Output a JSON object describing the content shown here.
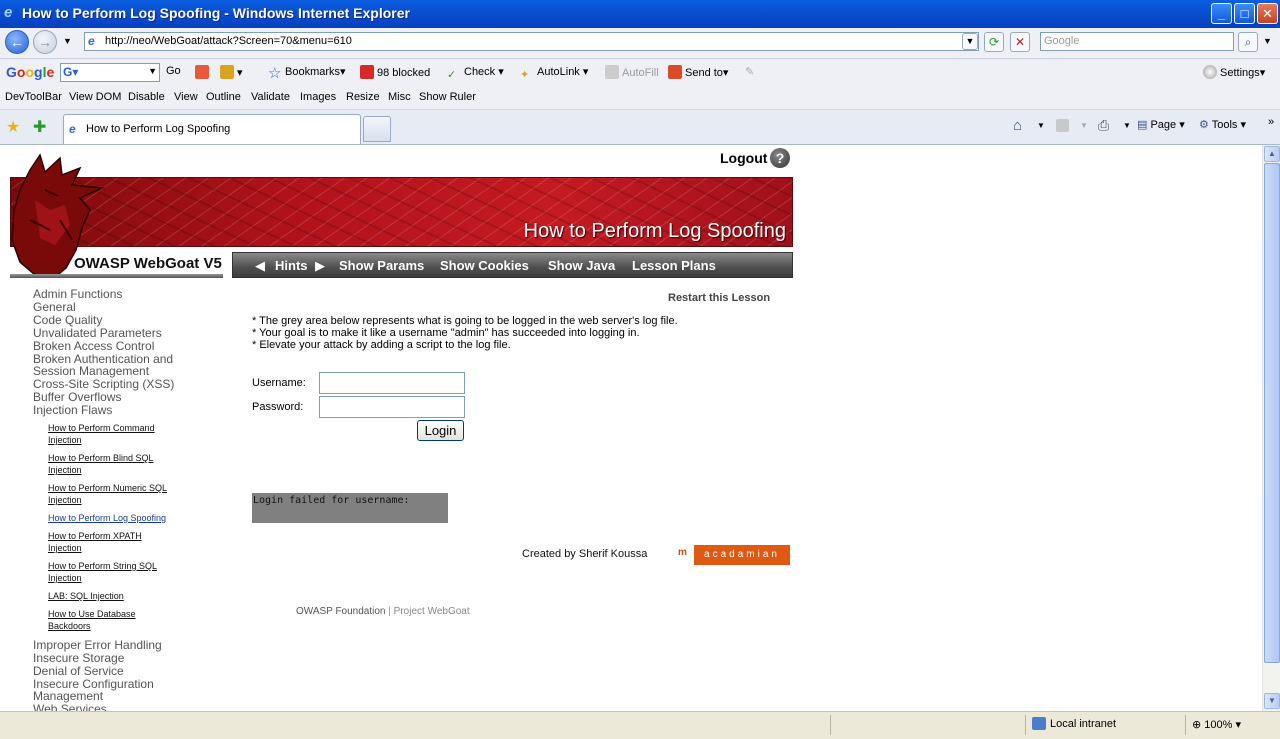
{
  "window": {
    "title": "How to Perform Log Spoofing - Windows Internet Explorer",
    "minimize": "_",
    "maximize": "□",
    "close": "✕"
  },
  "address_bar": {
    "url": "http://neo/WebGoat/attack?Screen=70&menu=610",
    "search_placeholder": "Google"
  },
  "google_toolbar": {
    "logo": "Google",
    "go": "Go",
    "bookmarks": "Bookmarks",
    "blocked": "98 blocked",
    "check": "Check",
    "autolink": "AutoLink",
    "autofill": "AutoFill",
    "sendto": "Send to",
    "settings": "Settings"
  },
  "dev_toolbar": {
    "items": [
      "DevToolBar",
      "View DOM",
      "Disable",
      "View",
      "Outline",
      "Validate",
      "Images",
      "Resize",
      "Misc",
      "Show Ruler"
    ]
  },
  "tabs": {
    "active": "How to Perform Log Spoofing",
    "page": "Page",
    "tools": "Tools"
  },
  "webgoat": {
    "logout": "Logout",
    "banner_title": "How to Perform Log Spoofing",
    "brand": "OWASP  WebGoat V5",
    "menu": {
      "prev_arrow": "◀",
      "hints": "Hints",
      "next_arrow": "▶",
      "show_params": "Show Params",
      "show_cookies": "Show Cookies",
      "show_java": "Show Java",
      "lesson_plans": "Lesson Plans"
    },
    "nav_top": [
      "Admin Functions",
      "General",
      "Code Quality",
      "Unvalidated Parameters",
      "Broken Access Control",
      "Broken Authentication and",
      "Session Management",
      "Cross-Site Scripting (XSS)",
      "Buffer Overflows",
      "Injection Flaws"
    ],
    "nav_sub": [
      [
        "How to Perform Command",
        "Injection"
      ],
      [
        "How to Perform Blind SQL",
        "Injection"
      ],
      [
        "How to Perform Numeric SQL",
        "Injection"
      ],
      [
        "How to Perform Log Spoofing"
      ],
      [
        "How to Perform XPATH",
        "Injection"
      ],
      [
        "How to Perform String SQL",
        "Injection"
      ],
      [
        "LAB: SQL Injection"
      ],
      [
        "How to Use Database",
        "Backdoors"
      ]
    ],
    "nav_bottom": [
      "Improper Error Handling",
      "Insecure Storage",
      "Denial of Service",
      "Insecure Configuration",
      "Management",
      "Web Services"
    ],
    "restart": "Restart this Lesson",
    "instructions": [
      "* The grey area below represents what is going to be logged in the web server's log file.",
      "* Your goal is to make it like a username \"admin\" has succeeded into logging in.",
      "* Elevate your attack by adding a script to the log file."
    ],
    "username_label": "Username:",
    "password_label": "Password:",
    "username_value": "",
    "password_value": "",
    "login_button": "Login",
    "log_text": "Login failed for username:",
    "credit": "Created by Sherif Koussa",
    "acad_m": "m",
    "acad_logo": "acadamian",
    "footer_foundation": "OWASP Foundation",
    "footer_sep": "|",
    "footer_project": "Project WebGoat"
  },
  "status_bar": {
    "zone": "Local intranet",
    "zoom": "100%"
  }
}
